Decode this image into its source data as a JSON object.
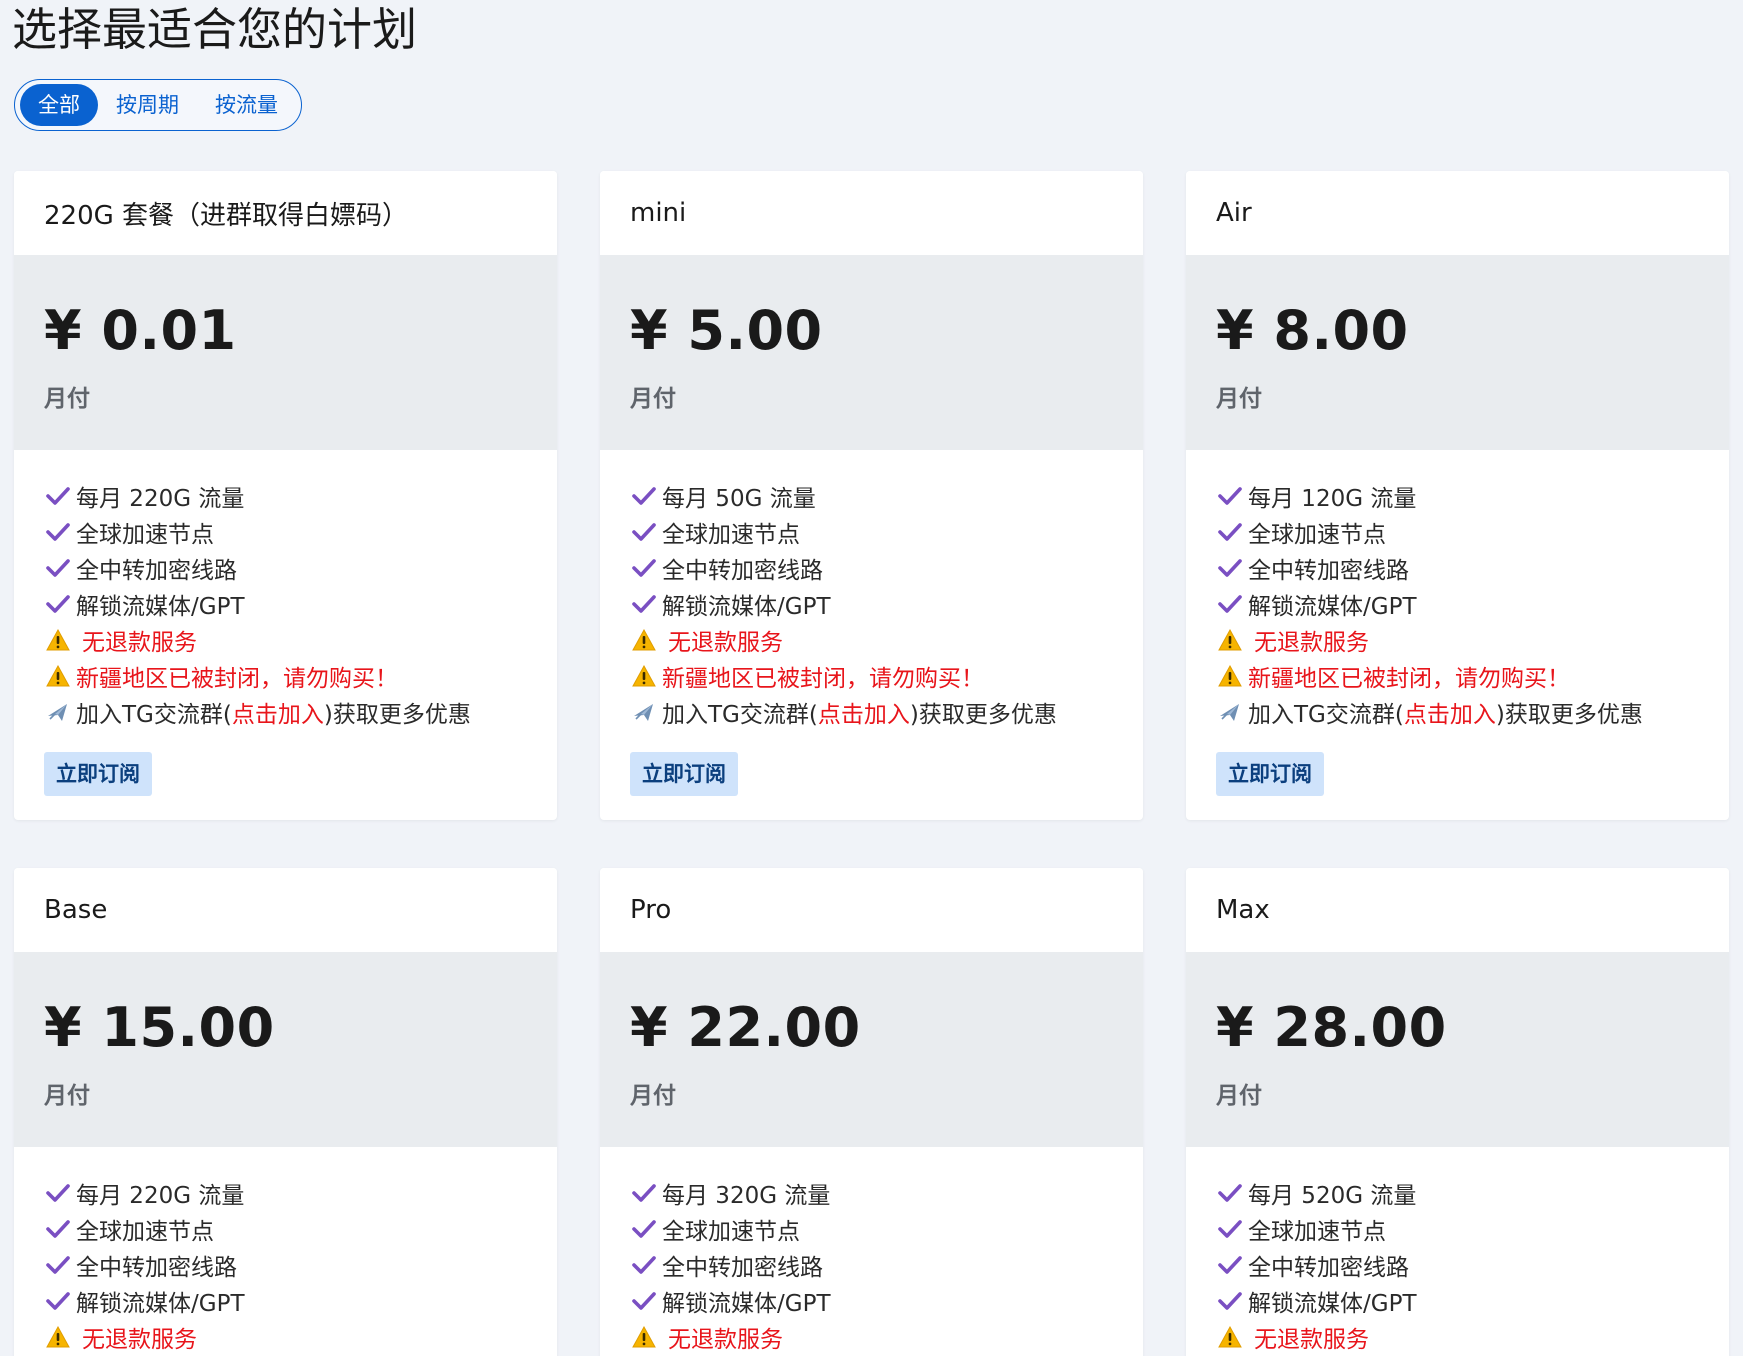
{
  "page": {
    "title": "选择最适合您的计划"
  },
  "filters": [
    {
      "label": "全部",
      "active": true
    },
    {
      "label": "按周期",
      "active": false
    },
    {
      "label": "按流量",
      "active": false
    }
  ],
  "colors": {
    "accent": "#0a62d0",
    "check": "#7a4fc2",
    "warning_text": "#e8151b",
    "price_block_bg": "#e9ecef",
    "button_bg": "#cfe3fb",
    "button_text": "#0b3f7e"
  },
  "plans": [
    {
      "name": "220G 套餐（进群取得白嫖码）",
      "price": "¥ 0.01",
      "period": "月付",
      "features": [
        "每月 220G 流量",
        "全球加速节点",
        "全中转加密线路",
        "解锁流媒体/GPT"
      ],
      "warnings": [
        "无退款服务",
        "新疆地区已被封闭，请勿购买！"
      ],
      "tg": {
        "before": "加入TG交流群(",
        "link": "点击加入",
        "after": ")获取更多优惠"
      },
      "button": "立即订阅"
    },
    {
      "name": "mini",
      "price": "¥ 5.00",
      "period": "月付",
      "features": [
        "每月 50G 流量",
        "全球加速节点",
        "全中转加密线路",
        "解锁流媒体/GPT"
      ],
      "warnings": [
        "无退款服务",
        "新疆地区已被封闭，请勿购买！"
      ],
      "tg": {
        "before": "加入TG交流群(",
        "link": "点击加入",
        "after": ")获取更多优惠"
      },
      "button": "立即订阅"
    },
    {
      "name": "Air",
      "price": "¥ 8.00",
      "period": "月付",
      "features": [
        "每月 120G 流量",
        "全球加速节点",
        "全中转加密线路",
        "解锁流媒体/GPT"
      ],
      "warnings": [
        "无退款服务",
        "新疆地区已被封闭，请勿购买！"
      ],
      "tg": {
        "before": "加入TG交流群(",
        "link": "点击加入",
        "after": ")获取更多优惠"
      },
      "button": "立即订阅"
    },
    {
      "name": "Base",
      "price": "¥ 15.00",
      "period": "月付",
      "features": [
        "每月 220G 流量",
        "全球加速节点",
        "全中转加密线路",
        "解锁流媒体/GPT"
      ],
      "warnings": [
        "无退款服务"
      ]
    },
    {
      "name": "Pro",
      "price": "¥ 22.00",
      "period": "月付",
      "features": [
        "每月 320G 流量",
        "全球加速节点",
        "全中转加密线路",
        "解锁流媒体/GPT"
      ],
      "warnings": [
        "无退款服务"
      ]
    },
    {
      "name": "Max",
      "price": "¥ 28.00",
      "period": "月付",
      "features": [
        "每月 520G 流量",
        "全球加速节点",
        "全中转加密线路",
        "解锁流媒体/GPT"
      ],
      "warnings": [
        "无退款服务"
      ]
    }
  ]
}
